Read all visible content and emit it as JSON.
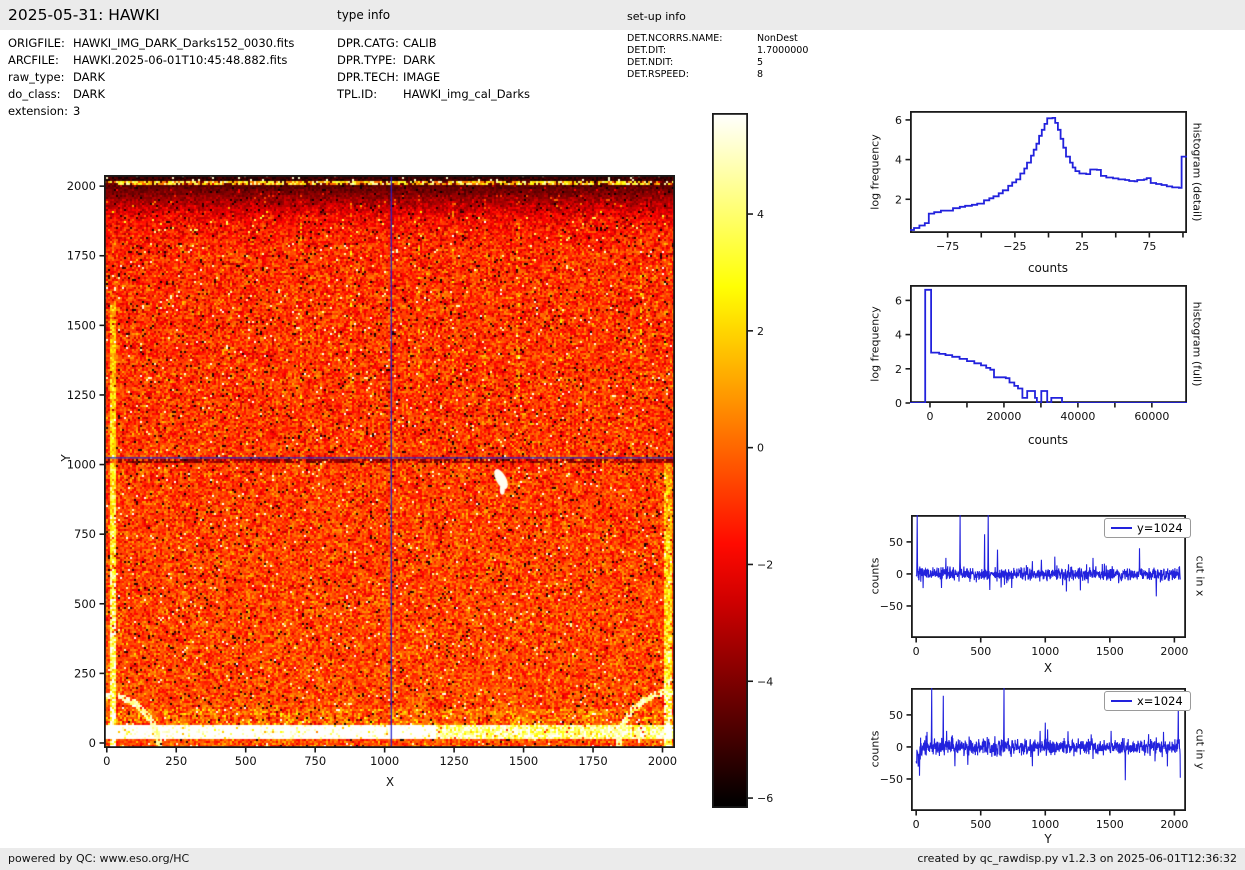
{
  "header": {
    "title": "2025-05-31: HAWKI",
    "type_info_label": "type info",
    "setup_info_label": "set-up info"
  },
  "file_info": {
    "rows": [
      {
        "label": "ORIGFILE:",
        "value": "HAWKI_IMG_DARK_Darks152_0030.fits"
      },
      {
        "label": "ARCFILE:",
        "value": "HAWKI.2025-06-01T10:45:48.882.fits"
      },
      {
        "label": "raw_type:",
        "value": "DARK"
      },
      {
        "label": "do_class:",
        "value": "DARK"
      },
      {
        "label": "extension:",
        "value": "3"
      }
    ]
  },
  "type_info": {
    "rows": [
      {
        "label": "DPR.CATG:",
        "value": "CALIB"
      },
      {
        "label": "DPR.TYPE:",
        "value": "DARK"
      },
      {
        "label": "DPR.TECH:",
        "value": "IMAGE"
      },
      {
        "label": "TPL.ID:",
        "value": "HAWKI_img_cal_Darks"
      }
    ]
  },
  "setup_info": {
    "rows": [
      {
        "label": "DET.NCORRS.NAME:",
        "value": "NonDest"
      },
      {
        "label": "DET.DIT:",
        "value": "1.7000000"
      },
      {
        "label": "DET.NDIT:",
        "value": "5"
      },
      {
        "label": "DET.RSPEED:",
        "value": "8"
      }
    ]
  },
  "footer": {
    "left": "powered by QC: www.eso.org/HC",
    "right": "created by qc_rawdisp.py v1.2.3 on 2025-06-01T12:36:32"
  },
  "colors": {
    "line_blue": "#2222dd",
    "crosshair_blue": "#2222cc",
    "frame_black": "#1a1a1a",
    "header_bg": "#ebebeb"
  },
  "chart_data": [
    {
      "type": "heatmap",
      "description": "Raw HAWKI dark frame displayed with hot colormap; noisy orange/red field, dark band along top edge with bright streak, bright white band along bottom edge, bright left/right edge strips, bright quarter-circle arcs in bottom corners, small white cosmetic blob near (1400,950), dark pixel row at y=1024",
      "colormap": "hot",
      "xlabel": "X",
      "ylabel": "Y",
      "xlim": [
        -10,
        2045
      ],
      "ylim": [
        -18,
        2040
      ],
      "xticks": [
        0,
        250,
        500,
        750,
        1000,
        1250,
        1500,
        1750,
        2000
      ],
      "yticks": [
        0,
        250,
        500,
        750,
        1000,
        1250,
        1500,
        1750,
        2000
      ],
      "crosshair": {
        "x": 1024,
        "y": 1024
      }
    },
    {
      "type": "colorbar",
      "orientation": "vertical",
      "colormap": "hot",
      "vmax": 5.73,
      "vmin": -6.17,
      "ticks": [
        4,
        2,
        0,
        -2,
        -4,
        -6
      ]
    },
    {
      "type": "step",
      "right_label": "histogram (detail)",
      "xlabel": "counts",
      "ylabel": "log frequency",
      "xlim": [
        -103,
        103
      ],
      "ylim": [
        0.3,
        6.45
      ],
      "xticks": [
        -75,
        -25,
        25,
        75
      ],
      "xticks_minor": [
        -50,
        0,
        50,
        100
      ],
      "yticks": [
        2,
        4,
        6
      ],
      "steps": [
        [
          -103,
          0.45
        ],
        [
          -100,
          0.55
        ],
        [
          -96,
          0.68
        ],
        [
          -92,
          0.8
        ],
        [
          -89,
          1.28
        ],
        [
          -85,
          1.35
        ],
        [
          -80,
          1.43
        ],
        [
          -71,
          1.55
        ],
        [
          -66,
          1.62
        ],
        [
          -62,
          1.67
        ],
        [
          -57,
          1.72
        ],
        [
          -53,
          1.78
        ],
        [
          -48,
          1.95
        ],
        [
          -44,
          2.05
        ],
        [
          -41,
          2.15
        ],
        [
          -37,
          2.3
        ],
        [
          -34,
          2.45
        ],
        [
          -30,
          2.68
        ],
        [
          -27,
          2.85
        ],
        [
          -24,
          3.0
        ],
        [
          -21,
          3.3
        ],
        [
          -18,
          3.55
        ],
        [
          -16,
          3.85
        ],
        [
          -13,
          4.2
        ],
        [
          -11,
          4.5
        ],
        [
          -9,
          4.8
        ],
        [
          -7,
          5.2
        ],
        [
          -5,
          5.5
        ],
        [
          -3,
          5.8
        ],
        [
          -1,
          6.08
        ],
        [
          3,
          6.1
        ],
        [
          5,
          5.85
        ],
        [
          7,
          5.5
        ],
        [
          9,
          5.05
        ],
        [
          11,
          4.6
        ],
        [
          13,
          4.15
        ],
        [
          16,
          3.85
        ],
        [
          18,
          3.6
        ],
        [
          20,
          3.42
        ],
        [
          23,
          3.3
        ],
        [
          28,
          3.27
        ],
        [
          31,
          3.5
        ],
        [
          36,
          3.48
        ],
        [
          39,
          3.18
        ],
        [
          43,
          3.1
        ],
        [
          48,
          3.05
        ],
        [
          52,
          3.0
        ],
        [
          57,
          2.97
        ],
        [
          60,
          2.92
        ],
        [
          64,
          2.9
        ],
        [
          66,
          2.97
        ],
        [
          71,
          3.0
        ],
        [
          73,
          3.07
        ],
        [
          76,
          2.82
        ],
        [
          80,
          2.77
        ],
        [
          84,
          2.72
        ],
        [
          88,
          2.65
        ],
        [
          92,
          2.6
        ],
        [
          97,
          2.58
        ],
        [
          99,
          4.15
        ],
        [
          103,
          4.15
        ]
      ]
    },
    {
      "type": "step",
      "right_label": "histogram (full)",
      "xlabel": "counts",
      "ylabel": "log frequency",
      "xlim": [
        -5400,
        69500
      ],
      "ylim": [
        0,
        6.9
      ],
      "xticks": [
        0,
        20000,
        40000,
        60000
      ],
      "xticks_minor": [
        10000,
        30000,
        50000
      ],
      "yticks": [
        0,
        2,
        4,
        6
      ],
      "steps": [
        [
          -5400,
          0
        ],
        [
          -1300,
          6.62
        ],
        [
          300,
          2.95
        ],
        [
          2500,
          2.87
        ],
        [
          4200,
          2.8
        ],
        [
          6000,
          2.7
        ],
        [
          8000,
          2.58
        ],
        [
          10000,
          2.45
        ],
        [
          12000,
          2.32
        ],
        [
          13800,
          2.2
        ],
        [
          15200,
          2.05
        ],
        [
          16300,
          1.95
        ],
        [
          17300,
          1.5
        ],
        [
          20500,
          1.45
        ],
        [
          21500,
          1.2
        ],
        [
          22800,
          1.0
        ],
        [
          23800,
          0.85
        ],
        [
          25000,
          0.3
        ],
        [
          26300,
          0.7
        ],
        [
          28400,
          0.3
        ],
        [
          28900,
          0
        ],
        [
          30100,
          0.7
        ],
        [
          31700,
          0
        ],
        [
          32800,
          0.3
        ],
        [
          35700,
          0
        ],
        [
          69500,
          0
        ]
      ]
    },
    {
      "type": "line-noise",
      "legend": "y=1024",
      "right_label": "cut in x",
      "xlabel": "X",
      "ylabel": "counts",
      "xlim": [
        -40,
        2090
      ],
      "ylim": [
        -100,
        92
      ],
      "xticks": [
        0,
        500,
        1000,
        1500,
        2000
      ],
      "yticks": [
        -50,
        0,
        50
      ],
      "noise_sd": 4.5,
      "seed": 7,
      "spikes": [
        {
          "x": 8,
          "v": 95
        },
        {
          "x": 195,
          "v": -22
        },
        {
          "x": 230,
          "v": 25
        },
        {
          "x": 340,
          "v": 95
        },
        {
          "x": 530,
          "v": 62
        },
        {
          "x": 558,
          "v": 95
        },
        {
          "x": 570,
          "v": -25
        },
        {
          "x": 630,
          "v": 38
        },
        {
          "x": 900,
          "v": 20
        },
        {
          "x": 970,
          "v": 22
        },
        {
          "x": 1180,
          "v": 15
        },
        {
          "x": 1370,
          "v": 25
        },
        {
          "x": 1730,
          "v": 40
        },
        {
          "x": 1860,
          "v": -35
        },
        {
          "x": 2040,
          "v": 12
        }
      ]
    },
    {
      "type": "line-noise",
      "legend": "x=1024",
      "right_label": "cut in y",
      "xlabel": "Y",
      "ylabel": "counts",
      "xlim": [
        -40,
        2090
      ],
      "ylim": [
        -100,
        92
      ],
      "xticks": [
        0,
        500,
        1000,
        1500,
        2000
      ],
      "yticks": [
        -50,
        0,
        50
      ],
      "noise_sd": 5.5,
      "seed": 13,
      "rough_start": {
        "until": 70,
        "amp": 32
      },
      "spikes": [
        {
          "x": 25,
          "v": -45
        },
        {
          "x": 120,
          "v": 95
        },
        {
          "x": 210,
          "v": 80
        },
        {
          "x": 235,
          "v": 25
        },
        {
          "x": 300,
          "v": -30
        },
        {
          "x": 400,
          "v": -28
        },
        {
          "x": 680,
          "v": 95
        },
        {
          "x": 900,
          "v": -30
        },
        {
          "x": 960,
          "v": 25
        },
        {
          "x": 1000,
          "v": 38
        },
        {
          "x": 1510,
          "v": 25
        },
        {
          "x": 1620,
          "v": -52
        },
        {
          "x": 1800,
          "v": 20
        },
        {
          "x": 2030,
          "v": 65
        },
        {
          "x": 2045,
          "v": -48
        }
      ]
    }
  ]
}
